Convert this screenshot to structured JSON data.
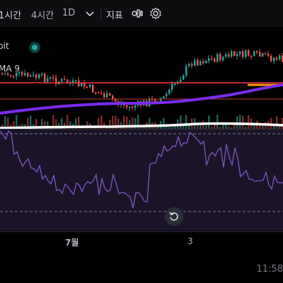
{
  "toolbar": {
    "interval_1h": "1시간",
    "interval_4h": "4시간",
    "interval_1d": "1D",
    "indicators_label": "지표"
  },
  "legend": {
    "exchange_fragment": "bit",
    "ma_fragment": "MA 9"
  },
  "time_axis": {
    "labels": [
      "7월",
      "3"
    ]
  },
  "footer": {
    "clock": "11:58"
  },
  "colors": {
    "up": "#26a69a",
    "down": "#ef5350",
    "price_line": "#f23645",
    "ma_purple": "#7b2cf0",
    "ma_white": "#ffffff",
    "rsi_line": "#7e57c2",
    "rsi_bg": "#1b1429",
    "last_price": "#ff9800"
  }
}
